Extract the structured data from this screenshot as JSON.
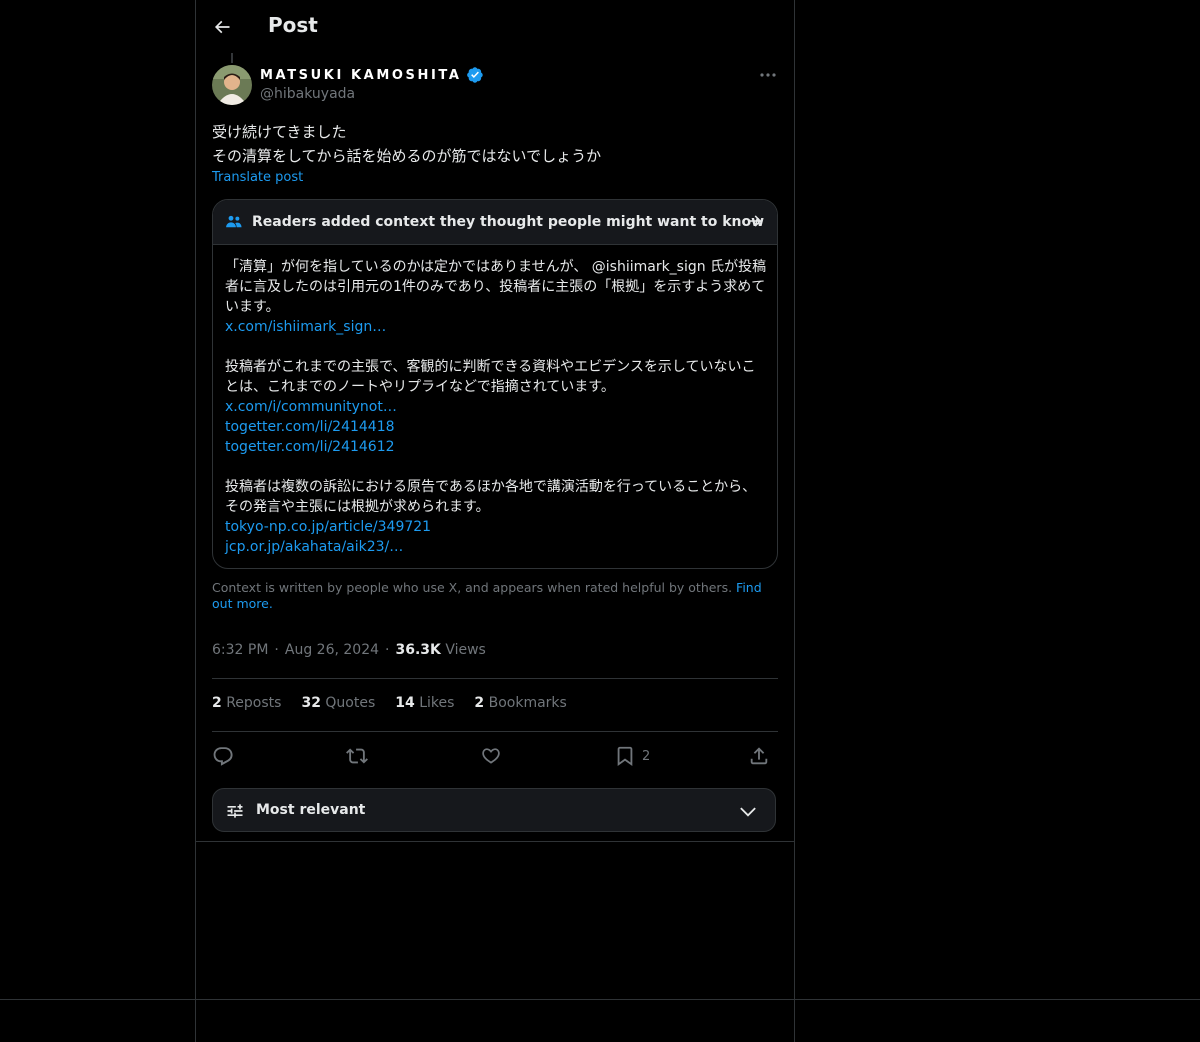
{
  "header": {
    "title": "Post"
  },
  "author": {
    "display_name": "MATSUKI KAMOSHITA",
    "handle": "@hibakuyada",
    "verified": true
  },
  "post": {
    "lines": [
      "受け続けてきました",
      "その清算をしてから話を始めるのが筋ではないでしょうか"
    ],
    "translate_label": "Translate post"
  },
  "community_note": {
    "title": "Readers added context they thought people might want to know",
    "paragraphs": [
      {
        "text": "「清算」が何を指しているのかは定かではありませんが、 @ishiimark_sign 氏が投稿者に言及したのは引用元の1件のみであり、投稿者に主張の「根拠」を示すよう求めています。",
        "links": [
          "x.com/ishiimark_sign…"
        ]
      },
      {
        "text": "投稿者がこれまでの主張で、客観的に判断できる資料やエビデンスを示していないことは、これまでのノートやリプライなどで指摘されています。",
        "links": [
          "x.com/i/communitynot…",
          "togetter.com/li/2414418",
          "togetter.com/li/2414612"
        ]
      },
      {
        "text": "投稿者は複数の訴訟における原告であるほか各地で講演活動を行っていることから、その発言や主張には根拠が求められます。",
        "links": [
          "tokyo-np.co.jp/article/349721",
          "jcp.or.jp/akahata/aik23/…"
        ]
      }
    ],
    "footer_text": "Context is written by people who use X, and appears when rated helpful by others.",
    "footer_link": "Find out more."
  },
  "meta": {
    "time": "6:32 PM",
    "date": "Aug 26, 2024",
    "views_count": "36.3K",
    "views_label": "Views"
  },
  "stats": [
    {
      "count": "2",
      "label": "Reposts"
    },
    {
      "count": "32",
      "label": "Quotes"
    },
    {
      "count": "14",
      "label": "Likes"
    },
    {
      "count": "2",
      "label": "Bookmarks"
    }
  ],
  "actions": {
    "bookmark_count": "2",
    "icons": [
      "reply-icon",
      "repost-icon",
      "like-icon",
      "bookmark-icon",
      "share-icon"
    ]
  },
  "sort": {
    "label": "Most relevant"
  },
  "colors": {
    "background": "#000000",
    "text": "#e7e9ea",
    "muted": "#71767b",
    "link": "#1d9bf0",
    "border": "#2f3336",
    "verified": "#1d9bf0"
  }
}
